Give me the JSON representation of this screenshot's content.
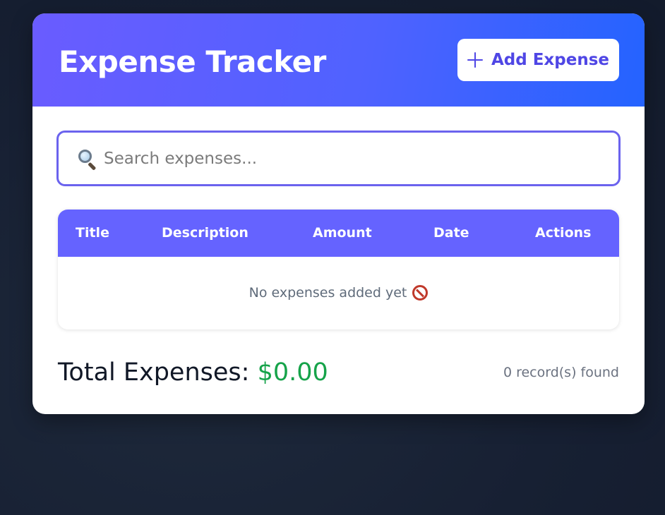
{
  "app": {
    "title": "Expense Tracker"
  },
  "header": {
    "add_button_label": "Add Expense",
    "add_button_icon": "plus-icon"
  },
  "search": {
    "placeholder": "Search expenses...",
    "value": "",
    "icon": "magnifying-glass-icon"
  },
  "table": {
    "columns": [
      "Title",
      "Description",
      "Amount",
      "Date",
      "Actions"
    ],
    "rows": [],
    "empty_message": "No expenses added yet",
    "empty_icon": "no-entry-icon"
  },
  "summary": {
    "total_label": "Total Expenses:",
    "total_value": "$0.00",
    "record_count": "0 record(s) found"
  },
  "colors": {
    "accent": "#6563ff",
    "header_gradient_start": "#6a5cff",
    "header_gradient_end": "#2463ff",
    "total_value": "#16a34a"
  }
}
